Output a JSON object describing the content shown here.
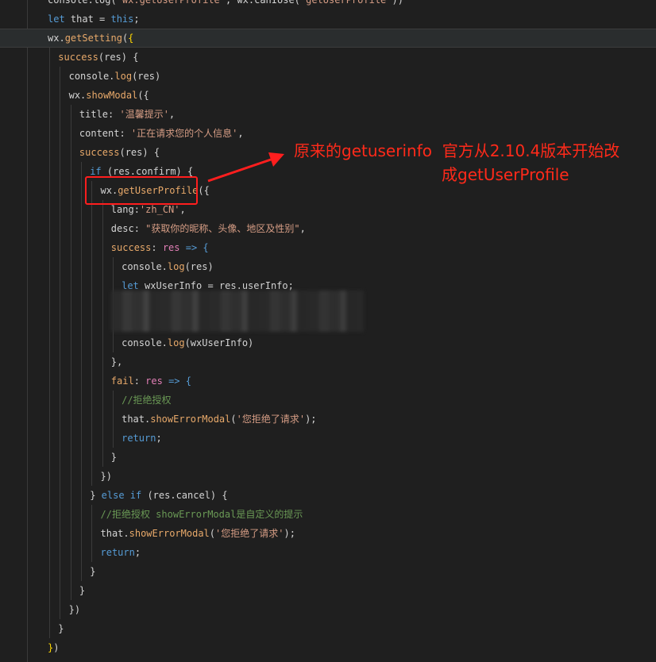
{
  "editor": {
    "lines": [
      {
        "indent": 0,
        "tokens": [
          [
            "console.log(",
            "c-text"
          ],
          [
            "'wx.getUserProfile'",
            "c-str"
          ],
          [
            ", wx.canIUse(",
            "c-text"
          ],
          [
            "'getUserProfile'",
            "c-str"
          ],
          [
            "))",
            "c-text"
          ]
        ]
      },
      {
        "indent": 0,
        "tokens": [
          [
            "let",
            "c-kw"
          ],
          [
            " that = ",
            "c-text"
          ],
          [
            "this",
            "c-kw"
          ],
          [
            ";",
            "c-text"
          ]
        ]
      },
      {
        "indent": 0,
        "active": true,
        "tokens": [
          [
            "wx.",
            "c-text"
          ],
          [
            "getSetting",
            "c-fn"
          ],
          [
            "(",
            "c-text"
          ],
          [
            "{",
            "c-brace-gold"
          ]
        ]
      },
      {
        "indent": 1,
        "tokens": [
          [
            "success",
            "c-fn"
          ],
          [
            "(res) {",
            "c-text"
          ]
        ]
      },
      {
        "indent": 2,
        "tokens": [
          [
            "console.",
            "c-text"
          ],
          [
            "log",
            "c-fn"
          ],
          [
            "(res)",
            "c-text"
          ]
        ]
      },
      {
        "indent": 2,
        "tokens": [
          [
            "wx.",
            "c-text"
          ],
          [
            "showModal",
            "c-fn"
          ],
          [
            "({",
            "c-text"
          ]
        ]
      },
      {
        "indent": 3,
        "tokens": [
          [
            "title: ",
            "c-text"
          ],
          [
            "'温馨提示'",
            "c-str"
          ],
          [
            ",",
            "c-text"
          ]
        ]
      },
      {
        "indent": 3,
        "tokens": [
          [
            "content: ",
            "c-text"
          ],
          [
            "'正在请求您的个人信息'",
            "c-str"
          ],
          [
            ",",
            "c-text"
          ]
        ]
      },
      {
        "indent": 3,
        "tokens": [
          [
            "success",
            "c-fn"
          ],
          [
            "(res) {",
            "c-text"
          ]
        ]
      },
      {
        "indent": 4,
        "tokens": [
          [
            "if",
            "c-kw"
          ],
          [
            " (res.confirm) {",
            "c-text"
          ]
        ]
      },
      {
        "indent": 5,
        "tokens": [
          [
            "wx.",
            "c-text"
          ],
          [
            "getUserProfile",
            "c-fn"
          ],
          [
            "({",
            "c-text"
          ]
        ]
      },
      {
        "indent": 6,
        "tokens": [
          [
            "lang:",
            "c-text"
          ],
          [
            "'zh_CN'",
            "c-str"
          ],
          [
            ",",
            "c-text"
          ]
        ]
      },
      {
        "indent": 6,
        "tokens": [
          [
            "desc: ",
            "c-text"
          ],
          [
            "\"获取你的昵称、头像、地区及性别\"",
            "c-str"
          ],
          [
            ",",
            "c-text"
          ]
        ]
      },
      {
        "indent": 6,
        "tokens": [
          [
            "success",
            "c-fn"
          ],
          [
            ": ",
            "c-text"
          ],
          [
            "res",
            "c-prop"
          ],
          [
            " => {",
            "c-kw"
          ]
        ]
      },
      {
        "indent": 7,
        "tokens": [
          [
            "console.",
            "c-text"
          ],
          [
            "log",
            "c-fn"
          ],
          [
            "(res)",
            "c-text"
          ]
        ]
      },
      {
        "indent": 7,
        "tokens": [
          [
            "let",
            "c-kw"
          ],
          [
            " wxUserInfo = res.userInfo;",
            "c-text"
          ]
        ]
      },
      {
        "indent": 7,
        "tokens": []
      },
      {
        "indent": 7,
        "tokens": []
      },
      {
        "indent": 7,
        "tokens": [
          [
            "console.",
            "c-text"
          ],
          [
            "log",
            "c-fn"
          ],
          [
            "(wxUserInfo)",
            "c-text"
          ]
        ]
      },
      {
        "indent": 6,
        "tokens": [
          [
            "},",
            "c-text"
          ]
        ]
      },
      {
        "indent": 6,
        "tokens": [
          [
            "fail",
            "c-fn"
          ],
          [
            ": ",
            "c-text"
          ],
          [
            "res",
            "c-prop"
          ],
          [
            " => {",
            "c-kw"
          ]
        ]
      },
      {
        "indent": 7,
        "tokens": [
          [
            "//拒绝授权",
            "c-com"
          ]
        ]
      },
      {
        "indent": 7,
        "tokens": [
          [
            "that.",
            "c-text"
          ],
          [
            "showErrorModal",
            "c-fn"
          ],
          [
            "(",
            "c-text"
          ],
          [
            "'您拒绝了请求'",
            "c-str"
          ],
          [
            ");",
            "c-text"
          ]
        ]
      },
      {
        "indent": 7,
        "tokens": [
          [
            "return",
            "c-kw"
          ],
          [
            ";",
            "c-text"
          ]
        ]
      },
      {
        "indent": 6,
        "tokens": [
          [
            "}",
            "c-text"
          ]
        ]
      },
      {
        "indent": 5,
        "tokens": [
          [
            "})",
            "c-text"
          ]
        ]
      },
      {
        "indent": 4,
        "tokens": [
          [
            "} ",
            "c-text"
          ],
          [
            "else",
            "c-kw"
          ],
          [
            " ",
            "c-text"
          ],
          [
            "if",
            "c-kw"
          ],
          [
            " (res.cancel) {",
            "c-text"
          ]
        ]
      },
      {
        "indent": 5,
        "tokens": [
          [
            "//拒绝授权 showErrorModal是自定义的提示",
            "c-com"
          ]
        ]
      },
      {
        "indent": 5,
        "tokens": [
          [
            "that.",
            "c-text"
          ],
          [
            "showErrorModal",
            "c-fn"
          ],
          [
            "(",
            "c-text"
          ],
          [
            "'您拒绝了请求'",
            "c-str"
          ],
          [
            ");",
            "c-text"
          ]
        ]
      },
      {
        "indent": 5,
        "tokens": [
          [
            "return",
            "c-kw"
          ],
          [
            ";",
            "c-text"
          ]
        ]
      },
      {
        "indent": 4,
        "tokens": [
          [
            "}",
            "c-text"
          ]
        ]
      },
      {
        "indent": 3,
        "tokens": [
          [
            "}",
            "c-text"
          ]
        ]
      },
      {
        "indent": 2,
        "tokens": [
          [
            "})",
            "c-text"
          ]
        ]
      },
      {
        "indent": 1,
        "tokens": [
          [
            "}",
            "c-text"
          ]
        ]
      },
      {
        "indent": 0,
        "tokens": [
          [
            "}",
            "c-brace-gold"
          ],
          [
            ")",
            "c-text"
          ]
        ]
      }
    ]
  },
  "annotation": {
    "note_line1": "原来的getuserinfo  官方从2.10.4版本开始改",
    "note_line2": "成getUserProfile",
    "color": "#ff2a1a"
  }
}
